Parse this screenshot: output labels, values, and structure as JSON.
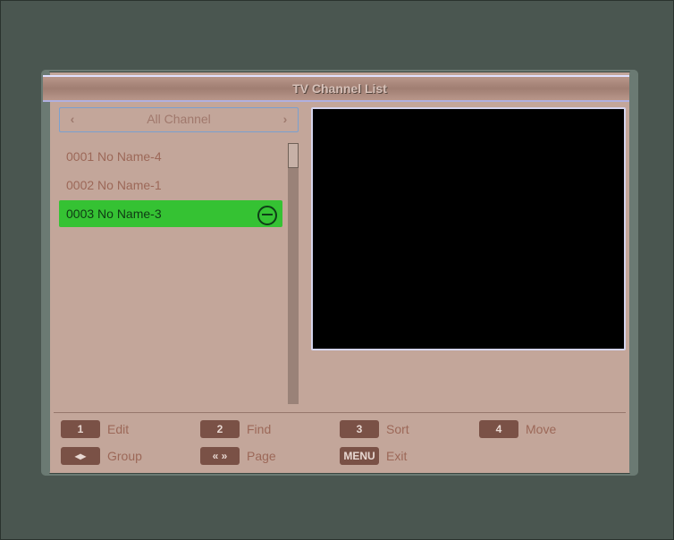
{
  "title": "TV Channel List",
  "filter": {
    "label": "All Channel",
    "prev": "‹",
    "next": "›"
  },
  "channels": [
    {
      "num": "0001",
      "name": "No Name-4",
      "selected": false
    },
    {
      "num": "0002",
      "name": "No Name-1",
      "selected": false
    },
    {
      "num": "0003",
      "name": "No Name-3",
      "selected": true
    }
  ],
  "footer": {
    "edit": {
      "key": "1",
      "label": "Edit"
    },
    "find": {
      "key": "2",
      "label": "Find"
    },
    "sort": {
      "key": "3",
      "label": "Sort"
    },
    "move": {
      "key": "4",
      "label": "Move"
    },
    "group": {
      "key": "◂▸",
      "label": "Group"
    },
    "page": {
      "key": "« »",
      "label": "Page"
    },
    "exit": {
      "key": "MENU",
      "label": "Exit"
    }
  }
}
